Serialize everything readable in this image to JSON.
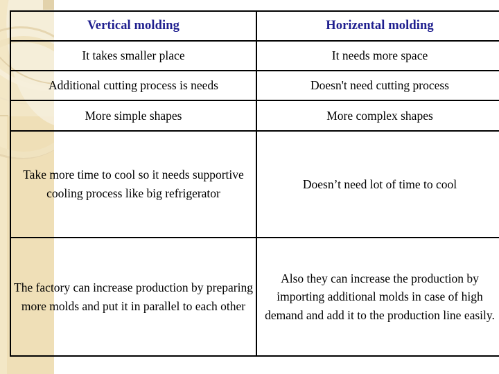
{
  "slide": {
    "background_color": "#ffffff",
    "accent_band_color": "#efdfb7",
    "header_text_color": "#1f1f8f",
    "body_text_color": "#000000",
    "border_color": "#000000"
  },
  "table": {
    "columns": [
      {
        "id": "vertical",
        "header": "Vertical molding"
      },
      {
        "id": "horizontal",
        "header": "Horizental molding"
      }
    ],
    "rows": [
      {
        "vertical": "It takes smaller place",
        "horizontal": "It needs more space"
      },
      {
        "vertical": "Additional cutting process is needs",
        "horizontal": "Doesn't need cutting process"
      },
      {
        "vertical": "More simple shapes",
        "horizontal": "More complex shapes"
      },
      {
        "vertical": "Take more time to cool so it needs supportive cooling  process like big refrigerator",
        "horizontal": "Doesn’t need lot of time to cool"
      },
      {
        "vertical": "The factory can increase production by preparing more molds and put it in parallel to each other",
        "horizontal": "Also they can increase the production by importing additional molds in case of high demand and add it to the production line easily."
      }
    ]
  }
}
